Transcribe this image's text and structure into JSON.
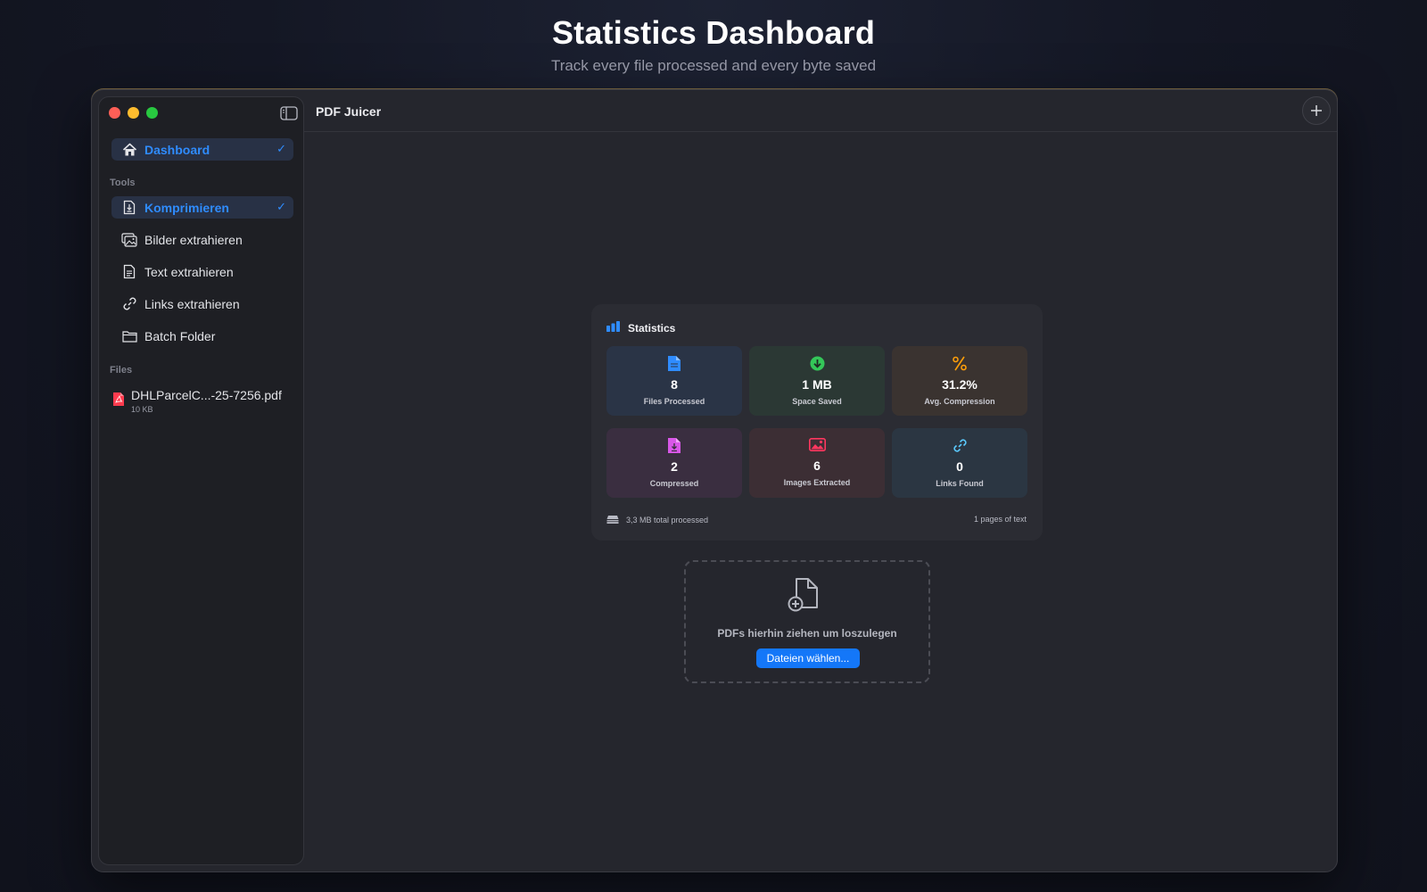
{
  "hero": {
    "title": "Statistics Dashboard",
    "subtitle": "Track every file processed and every byte saved"
  },
  "window": {
    "app_title": "PDF Juicer"
  },
  "sidebar": {
    "dashboard": {
      "label": "Dashboard",
      "icon": "house-icon",
      "selected": true
    },
    "tools_label": "Tools",
    "tools": [
      {
        "label": "Komprimieren",
        "icon": "document-compress-icon",
        "selected": true
      },
      {
        "label": "Bilder extrahieren",
        "icon": "images-icon",
        "selected": false
      },
      {
        "label": "Text extrahieren",
        "icon": "document-text-icon",
        "selected": false
      },
      {
        "label": "Links extrahieren",
        "icon": "link-icon",
        "selected": false
      },
      {
        "label": "Batch Folder",
        "icon": "folder-icon",
        "selected": false
      }
    ],
    "files_label": "Files",
    "files": [
      {
        "name": "DHLParcelC...-25-7256.pdf",
        "size": "10 KB",
        "icon": "pdf-file-icon"
      }
    ]
  },
  "statistics": {
    "title": "Statistics",
    "tiles": [
      {
        "value": "8",
        "label": "Files Processed",
        "icon": "document-icon",
        "color": "#2f8cff"
      },
      {
        "value": "1 MB",
        "label": "Space Saved",
        "icon": "arrow-down-circle-icon",
        "color": "#34c759"
      },
      {
        "value": "31.2%",
        "label": "Avg. Compression",
        "icon": "percent-icon",
        "color": "#ff9f0a"
      },
      {
        "value": "2",
        "label": "Compressed",
        "icon": "document-compress-icon",
        "color": "#d957e8"
      },
      {
        "value": "6",
        "label": "Images Extracted",
        "icon": "photo-icon",
        "color": "#ff375f"
      },
      {
        "value": "0",
        "label": "Links Found",
        "icon": "link-icon",
        "color": "#5ac8fa"
      }
    ],
    "footer_left": "3,3 MB total processed",
    "footer_right": "1 pages of text"
  },
  "dropzone": {
    "text": "PDFs hierhin ziehen um loszulegen",
    "button": "Dateien wählen..."
  },
  "colors": {
    "accent": "#2f8cff",
    "window_bg": "#25262d",
    "sidebar_bg": "#1e1f24"
  }
}
